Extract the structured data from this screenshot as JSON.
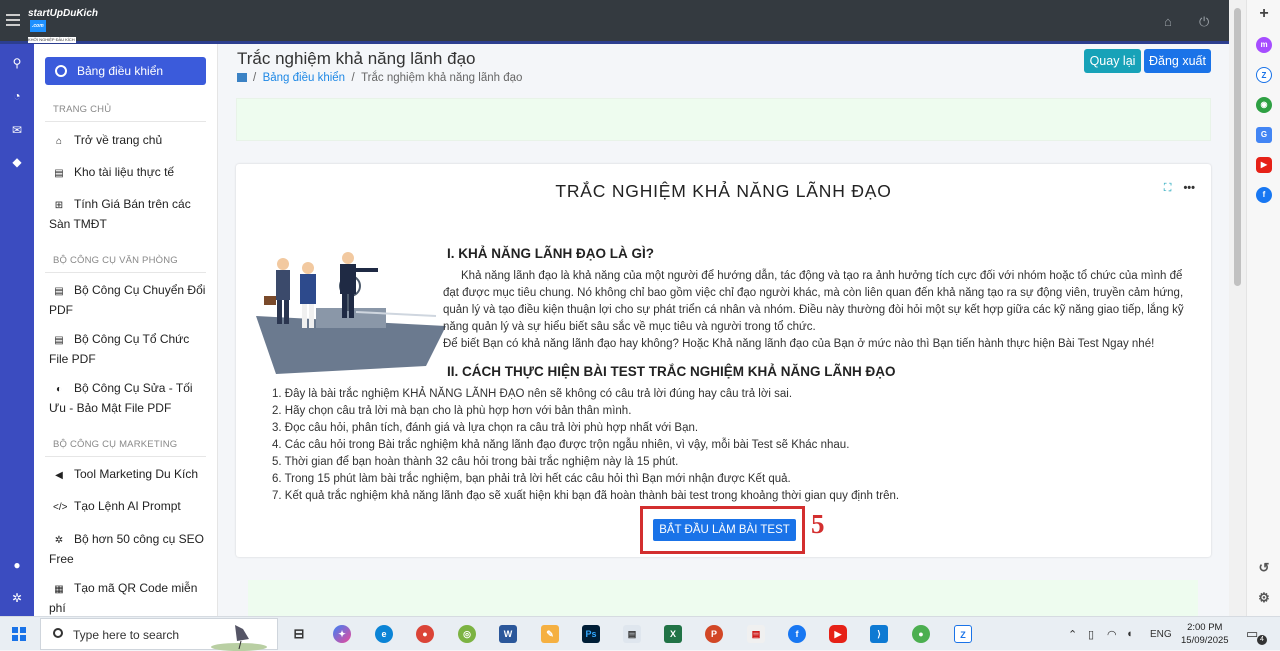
{
  "topbar": {
    "logo_text": "startUpDuKich",
    "logo_badge": ".com",
    "logo_tagline": "KHỞI NGHIỆP ĐẦU KÍCH"
  },
  "sidebar": {
    "dashboard": "Bảng điều khiển",
    "sections": [
      {
        "title": "TRANG CHỦ",
        "items": [
          "Trở về trang chủ",
          "Kho tài liệu thực tế",
          "Tính Giá Bán trên các Sàn TMĐT"
        ]
      },
      {
        "title": "BỘ CÔNG CỤ VĂN PHÒNG",
        "items": [
          "Bộ Công Cụ Chuyển Đổi PDF",
          "Bộ Công Cụ Tổ Chức File PDF",
          "Bộ Công Cụ Sửa - Tối Ưu - Bảo Mật File PDF"
        ]
      },
      {
        "title": "BỘ CÔNG CỤ MARKETING",
        "items": [
          "Tool Marketing Du Kích",
          "Tạo Lệnh AI Prompt",
          "Bộ hơn 50 công cụ SEO Free",
          "Tạo mã QR Code miễn phí"
        ]
      }
    ]
  },
  "header": {
    "title": "Trắc nghiệm khả năng lãnh đạo",
    "breadcrumb_link": "Bảng điều khiển",
    "breadcrumb_sep": "/",
    "breadcrumb_current": "Trắc nghiệm khả năng lãnh đạo",
    "back_label": "Quay lại",
    "logout_label": "Đăng xuất"
  },
  "card": {
    "title": "TRẮC NGHIỆM KHẢ NĂNG LÃNH ĐẠO",
    "section1_title": "I. KHẢ NĂNG LÃNH ĐẠO LÀ GÌ?",
    "section1_para": "Khả năng lãnh đạo là khả năng của một người để hướng dẫn, tác động và tạo ra ảnh hưởng tích cực đối với nhóm hoặc tổ chức của mình để đạt được mục tiêu chung. Nó không chỉ bao gồm việc chỉ đạo người khác, mà còn liên quan đến khả năng tạo ra sự động viên, truyền cảm hứng, quản lý và tạo điều kiện thuận lợi cho sự phát triển cá nhân và nhóm. Điều này thường đòi hỏi một sự kết hợp giữa các kỹ năng giao tiếp, lắng kỹ năng quản lý và sự hiểu biết sâu sắc về mục tiêu và người trong tổ chức.",
    "section1_para2": "Để biết Bạn có khả năng lãnh đạo hay không? Hoặc Khả năng lãnh đạo của Bạn ở mức nào thì Bạn tiến hành thực hiện Bài Test Ngay nhé!",
    "section2_title": "II. CÁCH THỰC HIỆN BÀI TEST TRẮC NGHIỆM KHẢ NĂNG LÃNH ĐẠO",
    "steps": [
      "1. Đây là bài trắc nghiệm KHẢ NĂNG LÃNH ĐẠO nên sẽ không có câu trả lời đúng hay câu trả lời sai.",
      "2. Hãy chọn câu trả lời mà bạn cho là phù hợp hơn với bản thân mình.",
      "3. Đọc câu hỏi, phân tích, đánh giá và lựa chọn ra câu trả lời phù hợp nhất với Bạn.",
      "4. Các câu hỏi trong Bài trắc nghiệm khả năng lãnh đạo được trộn ngẫu nhiên, vì vậy, mỗi bài Test sẽ Khác nhau.",
      "5. Thời gian để bạn hoàn thành 32 câu hỏi trong bài trắc nghiệm này là 15 phút.",
      "6. Trong 15 phút làm bài trắc nghiệm, bạn phải trả lời hết các câu hỏi thì Bạn mới nhận được Kết quả.",
      "7. Kết quả trắc nghiệm khả năng lãnh đạo sẽ xuất hiện khi bạn đã hoàn thành bài test trong khoảng thời gian quy định trên."
    ],
    "start_label": "BẮT ĐẦU LÀM BÀI TEST",
    "annotation_number": "5"
  },
  "taskbar": {
    "search_placeholder": "Type here to search",
    "language": "ENG",
    "time": "2:00 PM",
    "date": "15/09/2025",
    "notification_count": "4",
    "apps": [
      "task-view",
      "copilot",
      "edge",
      "chrome",
      "feedly",
      "word",
      "paint",
      "photoshop",
      "notepad",
      "excel",
      "powerpoint",
      "pdf",
      "facebook",
      "youtube",
      "vscode",
      "chrome-2",
      "zalo"
    ]
  },
  "colors": {
    "accent": "#3b5bdb",
    "teal": "#17a2b8",
    "primary": "#1a73e8",
    "highlight_red": "#d32f2f",
    "topbar": "#343a40"
  }
}
